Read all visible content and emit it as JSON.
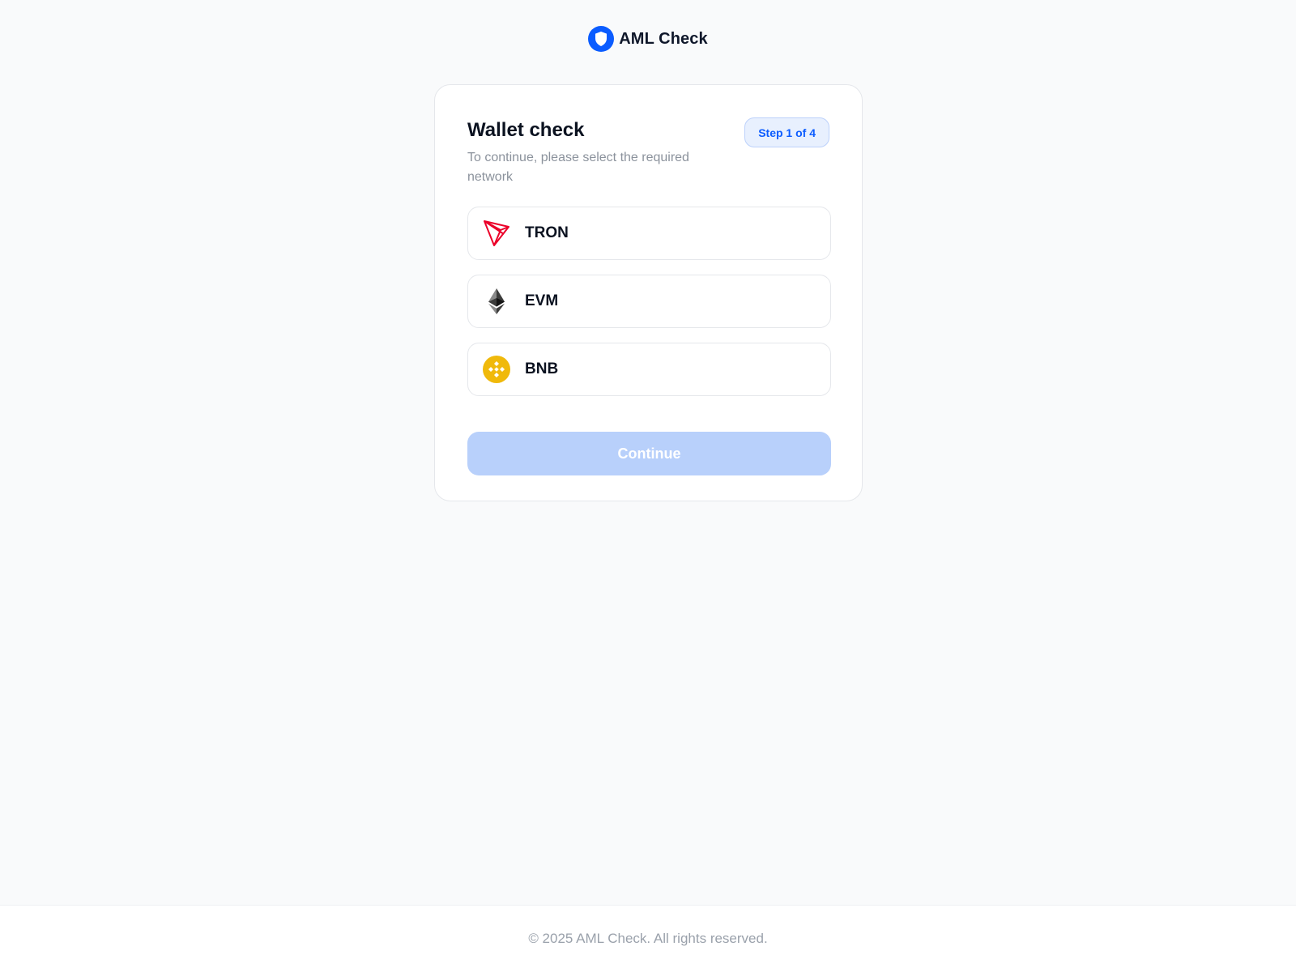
{
  "header": {
    "logo_icon": "shield-icon",
    "title": "AML Check"
  },
  "card": {
    "title": "Wallet check",
    "subtitle": "To continue, please select the required network",
    "step_badge": "Step 1 of 4",
    "networks": [
      {
        "label": "TRON",
        "icon": "tron-icon"
      },
      {
        "label": "EVM",
        "icon": "ethereum-icon"
      },
      {
        "label": "BNB",
        "icon": "bnb-icon"
      }
    ],
    "continue_label": "Continue"
  },
  "footer": {
    "text": "© 2025 AML Check. All rights reserved."
  },
  "colors": {
    "accent": "#0b5cff",
    "button_disabled": "#b8d0fb",
    "badge_bg": "#e8f0fe",
    "tron": "#eb0029",
    "bnb": "#f0b90b"
  }
}
